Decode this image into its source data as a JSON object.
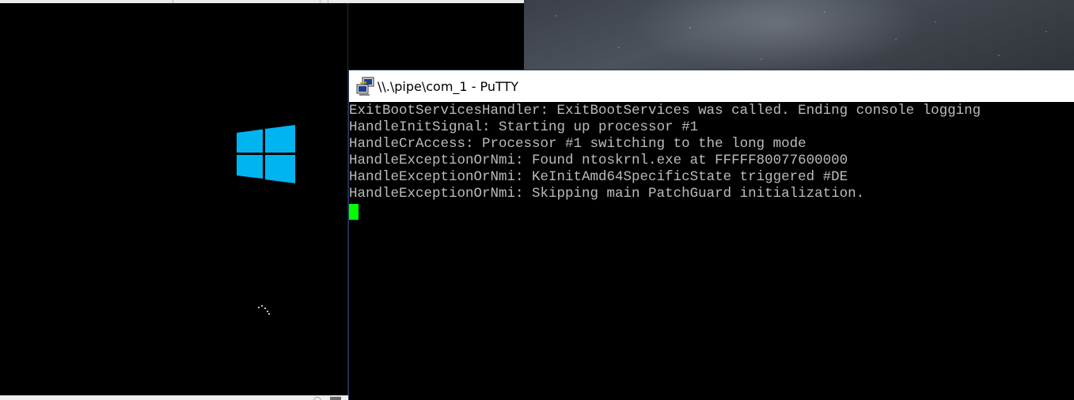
{
  "desktop": {
    "wallpaper": "starry-night-sky"
  },
  "vm_window": {
    "boot_logo": "windows-logo",
    "logo_color": "#00b4f0",
    "spinner": "boot-spinner"
  },
  "putty": {
    "title": "\\\\.\\pipe\\com_1 - PuTTY",
    "icon": "putty-icon",
    "foreground_color": "#bbbbbb",
    "background_color": "#000000",
    "cursor_color": "#00ff00",
    "lines": [
      "ExitBootServicesHandler: ExitBootServices was called. Ending console logging",
      "HandleInitSignal: Starting up processor #1",
      "HandleCrAccess: Processor #1 switching to the long mode",
      "HandleExceptionOrNmi: Found ntoskrnl.exe at FFFFF80077600000",
      "HandleExceptionOrNmi: KeInitAmd64SpecificState triggered #DE",
      "HandleExceptionOrNmi: Skipping main PatchGuard initialization."
    ]
  }
}
